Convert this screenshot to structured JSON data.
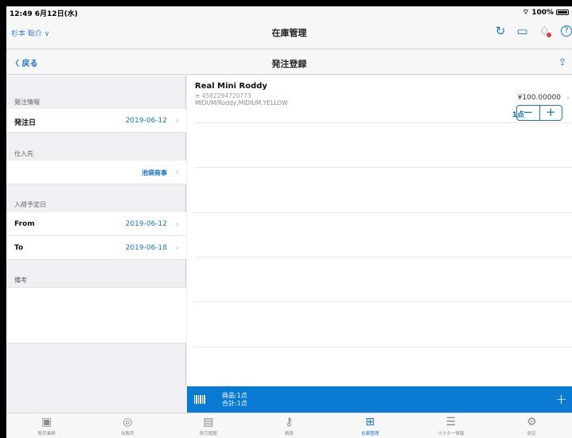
{
  "status": {
    "time": "12:49  6月12日(水)",
    "battery": "100%"
  },
  "topbar": {
    "user": "杉本 聡介 ∨",
    "title": "在庫管理",
    "icons": [
      "refresh-icon",
      "sidebar-icon",
      "bell-icon",
      "help-icon"
    ]
  },
  "nav": {
    "back": "〈 戻る",
    "title": "発注登録"
  },
  "form": {
    "order_info_header": "発注情報",
    "order_date_label": "発注日",
    "order_date_value": "2019-06-12",
    "supplier_header": "仕入先",
    "supplier_value": "池袋商事",
    "arrival_header": "入荷予定日",
    "from_label": "From",
    "from_value": "2019-06-12",
    "to_label": "To",
    "to_value": "2019-06-18",
    "memo_header": "備考"
  },
  "items": [
    {
      "name": "Real Mini Roddy",
      "code": "≡ 4582294720773",
      "variant": "MIDUM/Roddy,MIDIUM.YELLOW",
      "price": "¥100.00000",
      "qty": "1点"
    }
  ],
  "summary": {
    "products": "商品:1点",
    "total": "合計:1点"
  },
  "tabs": [
    {
      "label": "販売業務",
      "icon": "register-icon"
    },
    {
      "label": "仮販売",
      "icon": "temp-sale-icon"
    },
    {
      "label": "取引履歴",
      "icon": "history-icon"
    },
    {
      "label": "精算",
      "icon": "key-icon"
    },
    {
      "label": "在庫管理",
      "icon": "inventory-icon",
      "active": true
    },
    {
      "label": "マスター情報",
      "icon": "database-icon"
    },
    {
      "label": "設定",
      "icon": "settings-icon"
    }
  ],
  "colors": {
    "accent": "#1a73c9",
    "bar": "#0a7bd3"
  }
}
